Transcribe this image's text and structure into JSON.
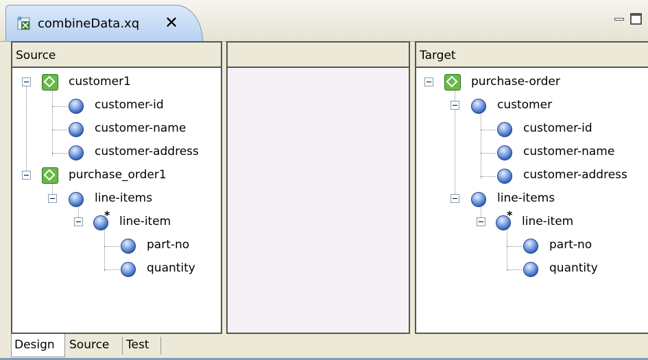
{
  "editor_tab": {
    "title": "combineData.xq",
    "icon": "xquery-file-icon",
    "close_icon": "close-x"
  },
  "window_controls": {
    "minimize": "minimize-icon",
    "maximize": "maximize-icon"
  },
  "panels": {
    "source": {
      "header": "Source",
      "tree": [
        {
          "label": "customer1",
          "type": "schema"
        },
        {
          "label": "customer-id",
          "type": "element"
        },
        {
          "label": "customer-name",
          "type": "element"
        },
        {
          "label": "customer-address",
          "type": "element"
        },
        {
          "label": "purchase_order1",
          "type": "schema"
        },
        {
          "label": "line-items",
          "type": "element"
        },
        {
          "label": "line-item",
          "type": "repeating-element"
        },
        {
          "label": "part-no",
          "type": "element"
        },
        {
          "label": "quantity",
          "type": "element"
        }
      ]
    },
    "middle": {
      "header": ""
    },
    "target": {
      "header": "Target",
      "tree": [
        {
          "label": "purchase-order",
          "type": "schema"
        },
        {
          "label": "customer",
          "type": "element"
        },
        {
          "label": "customer-id",
          "type": "element"
        },
        {
          "label": "customer-name",
          "type": "element"
        },
        {
          "label": "customer-address",
          "type": "element"
        },
        {
          "label": "line-items",
          "type": "element"
        },
        {
          "label": "line-item",
          "type": "repeating-element"
        },
        {
          "label": "part-no",
          "type": "element"
        },
        {
          "label": "quantity",
          "type": "element"
        }
      ]
    }
  },
  "bottom_tabs": [
    {
      "label": "Design",
      "active": true
    },
    {
      "label": "Source",
      "active": false
    },
    {
      "label": "Test",
      "active": false
    }
  ]
}
